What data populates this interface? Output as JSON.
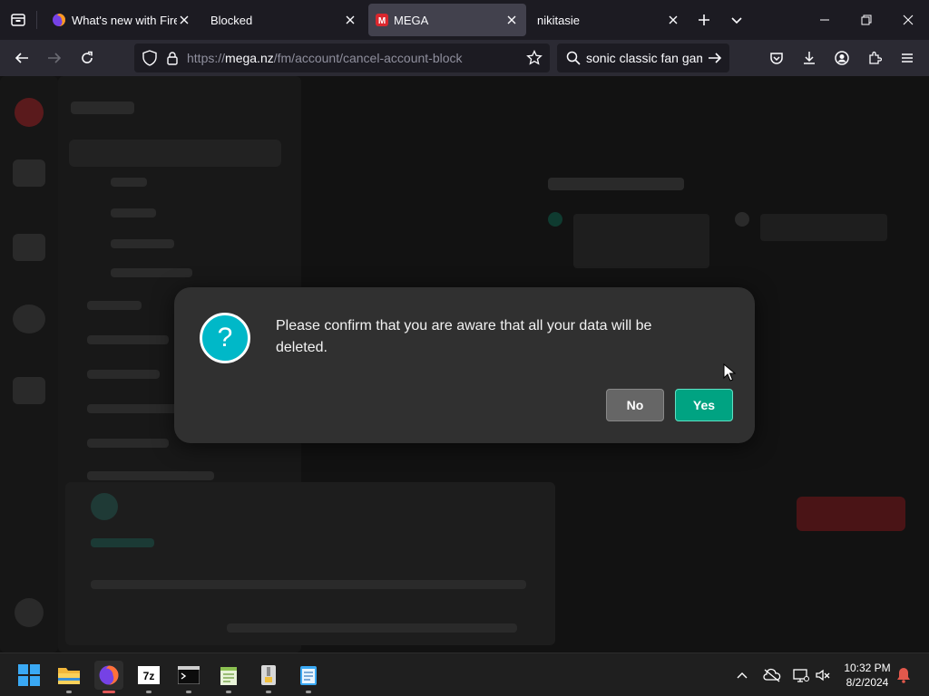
{
  "browser": {
    "tabs": [
      {
        "title": "What's new with Firefox",
        "icon": "firefox-icon",
        "selected": false
      },
      {
        "title": "Blocked",
        "icon": "",
        "selected": false
      },
      {
        "title": "MEGA",
        "icon": "mega-icon",
        "selected": true
      },
      {
        "title": "nikitasie",
        "icon": "",
        "selected": false
      }
    ],
    "url_host_prefix": "https://",
    "url_host": "mega.nz",
    "url_path": "/fm/account/cancel-account-block",
    "search_query": "sonic classic fan game"
  },
  "dialog": {
    "message": "Please confirm that you are aware that all your data will be deleted.",
    "no_label": "No",
    "yes_label": "Yes",
    "colors": {
      "yes": "#00a382",
      "icon": "#00b8c8"
    }
  },
  "taskbar": {
    "apps": [
      "start-icon",
      "file-explorer-icon",
      "firefox-icon",
      "7zip-icon",
      "terminal-icon",
      "notepad-plus-plus-icon",
      "archive-icon",
      "notepad-icon"
    ],
    "time": "10:32 PM",
    "date": "8/2/2024"
  }
}
